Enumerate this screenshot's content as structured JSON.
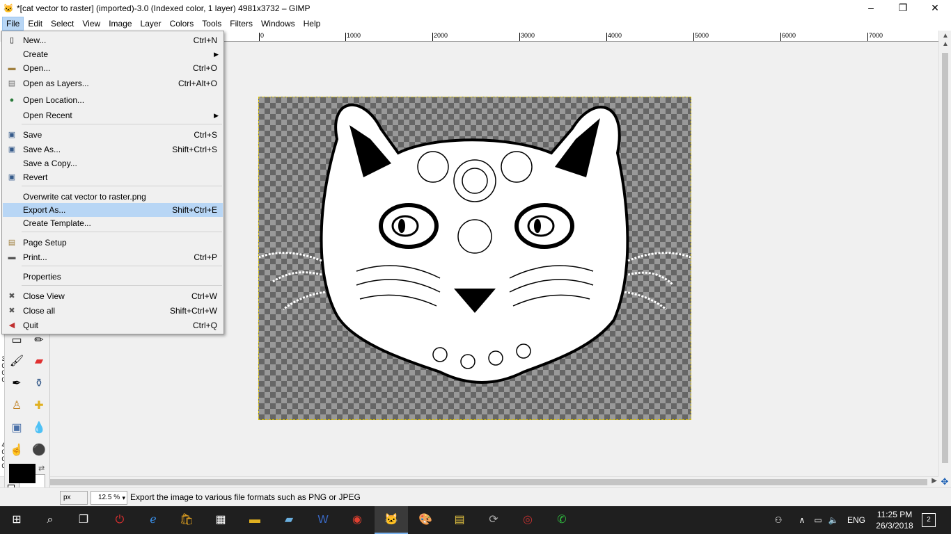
{
  "window": {
    "title": "*[cat vector to raster] (imported)-3.0 (Indexed color, 1 layer) 4981x3732 – GIMP",
    "minimize": "–",
    "maximize": "❐",
    "close": "✕"
  },
  "menubar": {
    "items": [
      "File",
      "Edit",
      "Select",
      "View",
      "Image",
      "Layer",
      "Colors",
      "Tools",
      "Filters",
      "Windows",
      "Help"
    ],
    "active": "File"
  },
  "ruler": {
    "top_labels": [
      "0",
      "1000",
      "2000",
      "3000",
      "4000",
      "5000",
      "6000",
      "7000"
    ],
    "left_labels": [
      "3",
      "0",
      "0",
      "0",
      "4",
      "0",
      "0",
      "0"
    ]
  },
  "file_menu": {
    "items": [
      {
        "label": "New...",
        "shortcut": "Ctrl+N",
        "icon": "new-doc-icon"
      },
      {
        "label": "Create",
        "shortcut": "",
        "submenu": true
      },
      {
        "label": "Open...",
        "shortcut": "Ctrl+O",
        "icon": "open-folder-icon"
      },
      {
        "label": "Open as Layers...",
        "shortcut": "Ctrl+Alt+O",
        "icon": "open-layers-icon"
      },
      {
        "label": "Open Location...",
        "shortcut": "",
        "icon": "globe-icon"
      },
      {
        "label": "Open Recent",
        "shortcut": "",
        "submenu": true
      },
      {
        "label": "Save",
        "shortcut": "Ctrl+S",
        "icon": "save-icon"
      },
      {
        "label": "Save As...",
        "shortcut": "Shift+Ctrl+S",
        "icon": "save-as-icon"
      },
      {
        "label": "Save a Copy...",
        "shortcut": ""
      },
      {
        "label": "Revert",
        "shortcut": "",
        "icon": "revert-icon"
      },
      {
        "label": "Overwrite cat vector to raster.png",
        "shortcut": ""
      },
      {
        "label": "Export As...",
        "shortcut": "Shift+Ctrl+E",
        "highlighted": true
      },
      {
        "label": "Create Template...",
        "shortcut": ""
      },
      {
        "label": "Page Setup",
        "shortcut": "",
        "icon": "page-setup-icon"
      },
      {
        "label": "Print...",
        "shortcut": "Ctrl+P",
        "icon": "printer-icon"
      },
      {
        "label": "Properties",
        "shortcut": ""
      },
      {
        "label": "Close View",
        "shortcut": "Ctrl+W",
        "icon": "close-x-icon"
      },
      {
        "label": "Close all",
        "shortcut": "Shift+Ctrl+W",
        "icon": "close-x-icon"
      },
      {
        "label": "Quit",
        "shortcut": "Ctrl+Q",
        "icon": "quit-icon"
      }
    ]
  },
  "statusbar": {
    "unit": "px",
    "zoom": "12.5 %",
    "message": "Export the image to various file formats such as PNG or JPEG"
  },
  "colors": {
    "menu_highlight": "#b8d6f5",
    "selection_border": "#d8c000",
    "taskbar_bg": "#1f1f1f"
  },
  "taskbar": {
    "language": "ENG",
    "time": "11:25 PM",
    "date": "26/3/2018",
    "notifications": "2"
  }
}
